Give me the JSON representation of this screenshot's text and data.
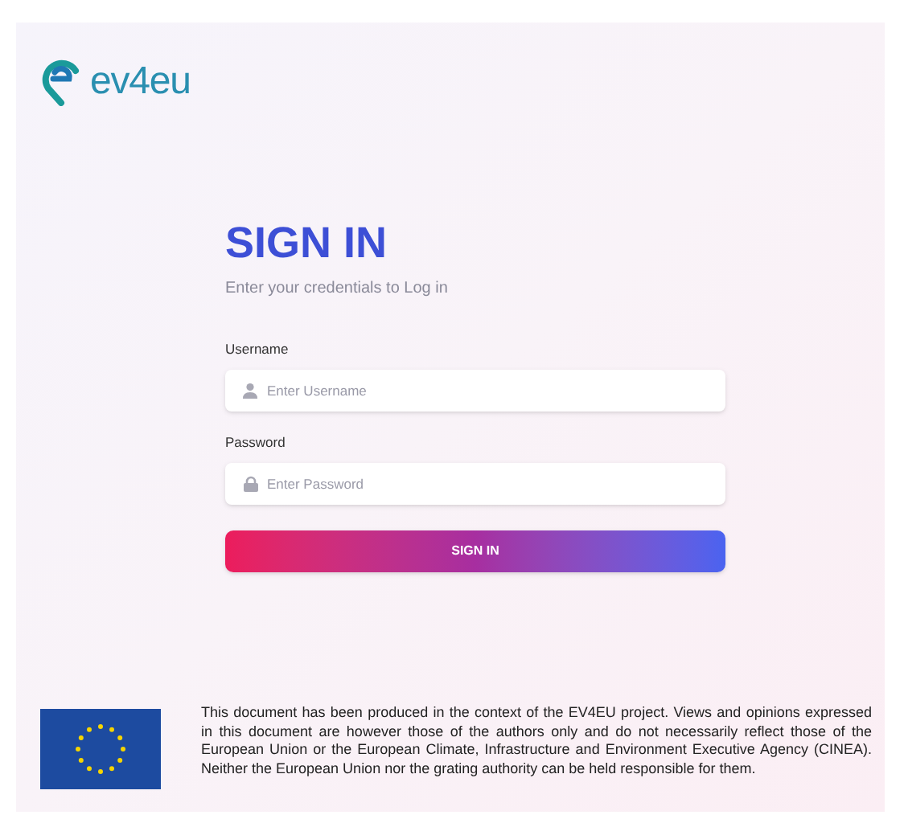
{
  "logo": {
    "text": "ev4eu"
  },
  "form": {
    "title": "SIGN IN",
    "subtitle": "Enter your credentials to Log in",
    "fields": [
      {
        "kind": "user",
        "label": "Username",
        "placeholder": "Enter Username"
      },
      {
        "kind": "lock",
        "label": "Password",
        "placeholder": "Enter Password"
      }
    ],
    "button": "SIGN IN"
  },
  "footer": {
    "disclaimer": "This document has been produced in the context of the EV4EU project. Views and opinions expressed in this document are however those of the authors only and do not necessarily reflect those of the European Union or the European Climate, Infrastructure and Environment Executive Agency (CINEA). Neither the European Union nor the grating authority can be held responsible for them."
  }
}
